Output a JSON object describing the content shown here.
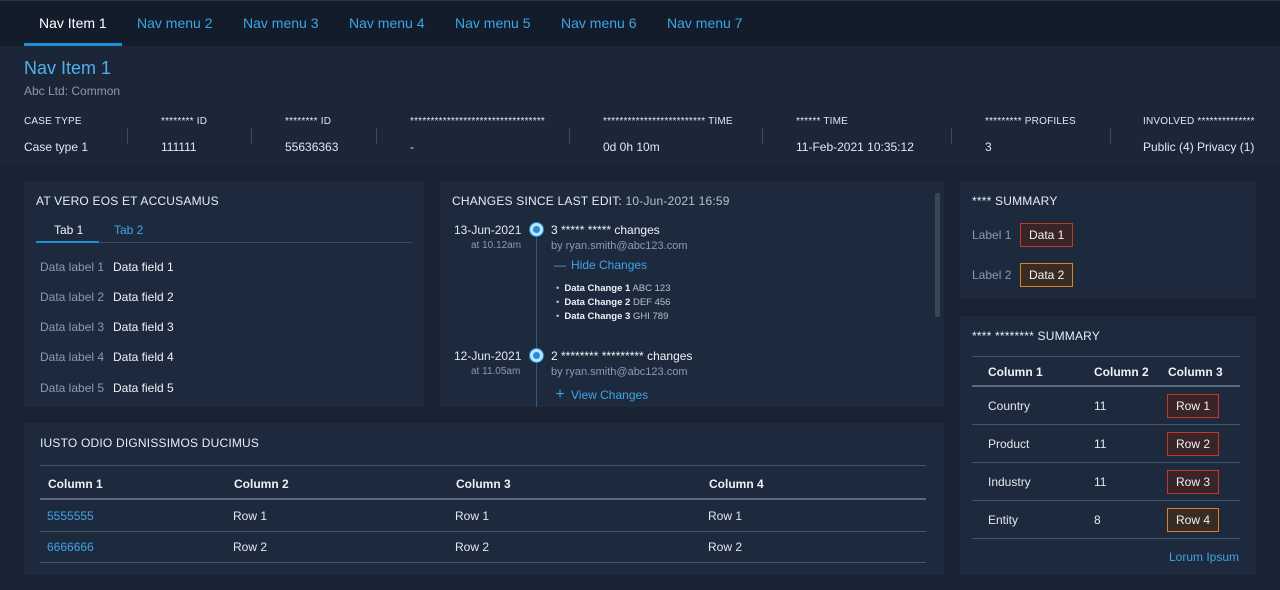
{
  "nav": {
    "items": [
      "Nav Item 1",
      "Nav menu 2",
      "Nav menu 3",
      "Nav menu 4",
      "Nav menu 5",
      "Nav menu 6",
      "Nav menu 7"
    ]
  },
  "header": {
    "title": "Nav Item 1",
    "subtitle": "Abc Ltd: Common"
  },
  "meta": [
    {
      "label": "CASE TYPE",
      "value": "Case type 1"
    },
    {
      "label": "******** ID",
      "value": "111111"
    },
    {
      "label": "******** ID",
      "value": "55636363"
    },
    {
      "label": "*********************************",
      "value": "-"
    },
    {
      "label": "************************* TIME",
      "value": "0d 0h 10m"
    },
    {
      "label": "****** TIME",
      "value": "11-Feb-2021 10:35:12"
    },
    {
      "label": "********* PROFILES",
      "value": "3"
    },
    {
      "label": "INVOLVED **************",
      "value": "Public (4) Privacy (1)"
    }
  ],
  "details_card": {
    "title": "AT VERO EOS ET ACCUSAMUS",
    "tabs": [
      "Tab 1",
      "Tab 2"
    ],
    "rows": [
      {
        "label": "Data label 1",
        "value": "Data field 1"
      },
      {
        "label": "Data label 2",
        "value": "Data field 2"
      },
      {
        "label": "Data label 3",
        "value": "Data field 3"
      },
      {
        "label": "Data label 4",
        "value": "Data field 4"
      },
      {
        "label": "Data label 5",
        "value": "Data field 5"
      }
    ]
  },
  "changes_card": {
    "title": "CHANGES SINCE LAST EDIT:",
    "last_edit": "10-Jun-2021 16:59",
    "entries": [
      {
        "date": "13-Jun-2021",
        "time": "at 10.12am",
        "heading": "3 ***** ***** changes",
        "by": "by ryan.smith@abc123.com",
        "toggle": "Hide Changes",
        "toggle_icon": "minus-icon",
        "changes": [
          {
            "name": "Data Change 1",
            "value": "ABC 123"
          },
          {
            "name": "Data Change 2",
            "value": "DEF 456"
          },
          {
            "name": "Data Change 3",
            "value": "GHI 789"
          }
        ]
      },
      {
        "date": "12-Jun-2021",
        "time": "at 11.05am",
        "heading": "2 ******** ********* changes",
        "by": "by ryan.smith@abc123.com",
        "toggle": "View Changes",
        "toggle_icon": "plus-icon"
      }
    ]
  },
  "summary_card": {
    "title": "**** SUMMARY",
    "items": [
      {
        "label": "Label 1",
        "value": "Data 1",
        "color": "#c0392b"
      },
      {
        "label": "Label 2",
        "value": "Data 2",
        "color": "#d9822b"
      }
    ]
  },
  "summary2_card": {
    "title": "**** ******** SUMMARY",
    "columns": [
      "Column 1",
      "Column 2",
      "Column 3"
    ],
    "rows": [
      {
        "c1": "Country",
        "c2": "11",
        "c3": "Row 1",
        "color": "#c0392b"
      },
      {
        "c1": "Product",
        "c2": "11",
        "c3": "Row 2",
        "color": "#c0392b"
      },
      {
        "c1": "Industry",
        "c2": "11",
        "c3": "Row 3",
        "color": "#c0392b"
      },
      {
        "c1": "Entity",
        "c2": "8",
        "c3": "Row 4",
        "color": "#d9822b"
      }
    ],
    "footer_link": "Lorum Ipsum"
  },
  "table_card": {
    "title": "IUSTO ODIO DIGNISSIMOS DUCIMUS",
    "columns": [
      "Column 1",
      "Column 2",
      "Column 3",
      "Column 4"
    ],
    "rows": [
      [
        "5555555",
        "Row 1",
        "Row 1",
        "Row 1"
      ],
      [
        "6666666",
        "Row 2",
        "Row 2",
        "Row 2"
      ]
    ]
  }
}
